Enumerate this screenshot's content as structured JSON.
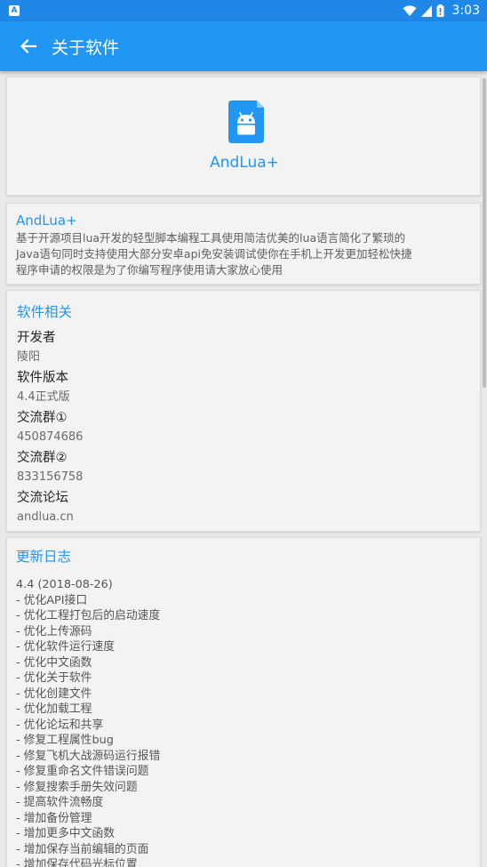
{
  "status_bar": {
    "time": "3:03",
    "left_icon_letter": "A",
    "icons": [
      "wifi-icon",
      "signal-icon",
      "battery-icon"
    ]
  },
  "app_bar": {
    "title": "关于软件"
  },
  "logo_card": {
    "app_name": "AndLua+"
  },
  "description": {
    "title": "AndLua+",
    "lines": [
      "基于开源项目lua开发的轻型脚本编程工具使用简洁优美的lua语言简化了繁琐的",
      "Java语句同时支持使用大部分安卓api免安装调试使你在手机上开发更加轻松快捷",
      "程序申请的权限是为了你编写程序使用请大家放心使用"
    ]
  },
  "software_info": {
    "title": "软件相关",
    "items": [
      {
        "label": "开发者",
        "value": "陵阳"
      },
      {
        "label": "软件版本",
        "value": "4.4正式版"
      },
      {
        "label": "交流群①",
        "value": "450874686"
      },
      {
        "label": "交流群②",
        "value": "833156758"
      },
      {
        "label": "交流论坛",
        "value": "andlua.cn"
      }
    ]
  },
  "changelog": {
    "title": "更新日志",
    "lines": [
      "4.4 (2018-08-26)",
      "- 优化API接口",
      "- 优化工程打包后的启动速度",
      "- 优化上传源码",
      "- 优化软件运行速度",
      "- 优化中文函数",
      "- 优化关于软件",
      "- 优化创建文件",
      "- 优化加载工程",
      "- 优化论坛和共享",
      "- 修复工程属性bug",
      "- 修复飞机大战源码运行报错",
      "- 修复重命名文件错误问题",
      "- 修复搜索手册失效问题",
      "- 提高软件流畅度",
      "- 增加备份管理",
      "- 增加更多中文函数",
      "- 增加保存当前编辑的页面",
      "- 增加保存代码光标位置"
    ]
  },
  "colors": {
    "primary": "#2196f3",
    "status_bar": "#1f87e5",
    "background": "#e9e9e9"
  }
}
